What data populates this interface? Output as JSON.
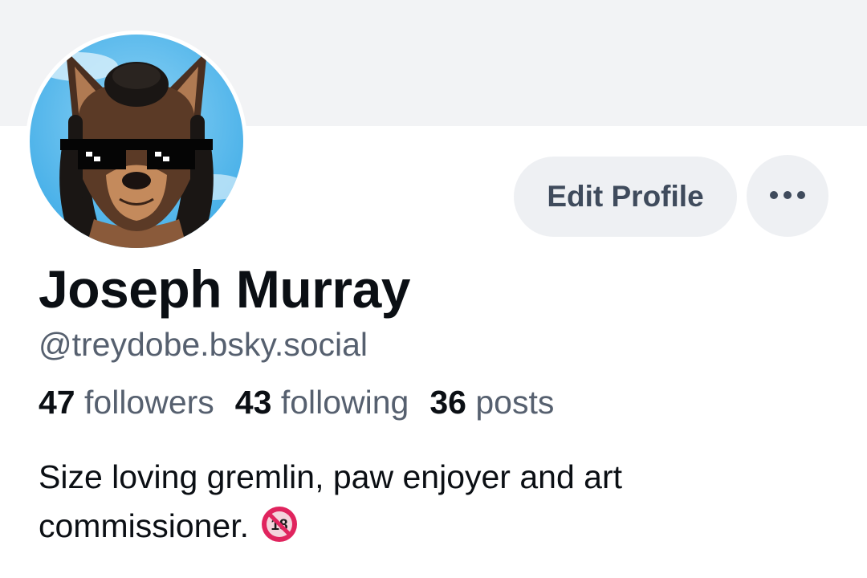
{
  "profile": {
    "display_name": "Joseph Murray",
    "handle": "@treydobe.bsky.social",
    "avatar_icon": "profile-avatar",
    "stats": {
      "followers_count": "47",
      "followers_label": "followers",
      "following_count": "43",
      "following_label": "following",
      "posts_count": "36",
      "posts_label": "posts"
    },
    "bio": "Size loving gremlin, paw enjoyer and art commissioner.",
    "bio_emoji_icon": "no-one-under-eighteen-icon"
  },
  "actions": {
    "edit_profile_label": "Edit Profile",
    "more_icon": "more-horizontal-icon"
  },
  "colors": {
    "banner": "#f2f3f5",
    "button_bg": "#eef0f3",
    "text_primary": "#0b0f14",
    "text_secondary": "#56606f"
  }
}
